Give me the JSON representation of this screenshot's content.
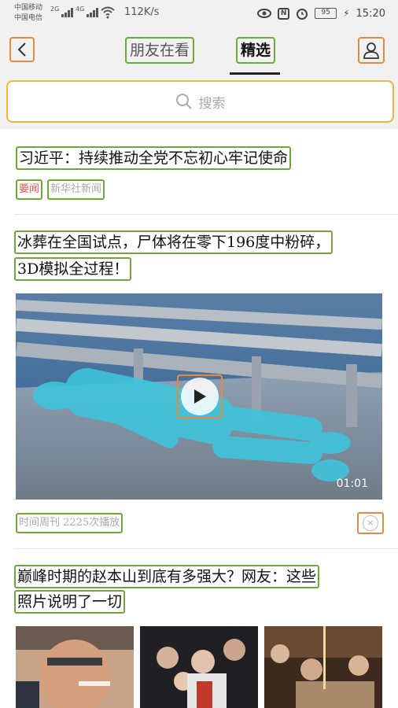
{
  "status_bar": {
    "carrier_1": "中国移动",
    "carrier_2": "中国电信",
    "signal_1": "2G",
    "signal_2": "4G",
    "speed": "112K/s",
    "nfc": "N",
    "battery": "95",
    "time": "15:20"
  },
  "header": {
    "tab_friends": "朋友在看",
    "tab_selected": "精选"
  },
  "search": {
    "placeholder": "搜索"
  },
  "feed": [
    {
      "title": "习近平：持续推动全党不忘初心牢记使命",
      "tag": "要闻",
      "source": "新华社新闻"
    },
    {
      "title_line1": "冰葬在全国试点，尸体将在零下196度中粉碎，",
      "title_line2": "3D模拟全过程！",
      "duration": "01:01",
      "meta": "时间周刊  2225次播放",
      "close_label": "×"
    },
    {
      "title_line1": "巅峰时期的赵本山到底有多强大？网友：这些",
      "title_line2": "照片说明了一切"
    }
  ],
  "colors": {
    "annotation_green": "#6ea83b",
    "annotation_orange": "#e88a3c",
    "annotation_yellow": "#f0b83a",
    "tag_red": "#e8574f"
  }
}
